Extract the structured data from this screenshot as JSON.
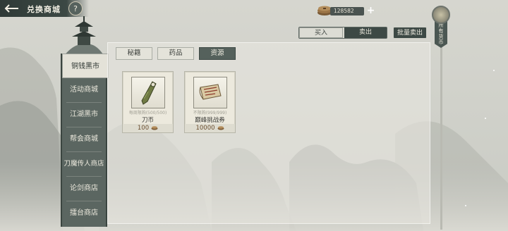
{
  "header": {
    "title": "兑换商城",
    "help_label": "?"
  },
  "currency": {
    "amount": "128582",
    "plus_label": "+"
  },
  "trade": {
    "buy_label": "买入",
    "sell_label": "卖出",
    "bulk_sell_label": "批量卖出",
    "selected": "buy"
  },
  "ornament": {
    "banner_chars": [
      "所",
      "有",
      "货",
      "币"
    ]
  },
  "sidebar": {
    "items": [
      {
        "label": "铜钱黑市",
        "active": true
      },
      {
        "label": "活动商城",
        "active": false
      },
      {
        "label": "江湖黑市",
        "active": false
      },
      {
        "label": "帮会商城",
        "active": false
      },
      {
        "label": "刀魔传人商店",
        "active": false
      },
      {
        "label": "论剑商店",
        "active": false
      },
      {
        "label": "擂台商店",
        "active": false
      }
    ]
  },
  "category_tabs": [
    {
      "label": "秘籍",
      "active": false
    },
    {
      "label": "药品",
      "active": false
    },
    {
      "label": "资源",
      "active": true
    }
  ],
  "items": [
    {
      "name": "刀币",
      "limit": "每周限购(500/500)",
      "price": "100",
      "icon": "blade-coin-icon"
    },
    {
      "name": "巅峰挑战券",
      "limit": "不限购(999/999)",
      "price": "10000",
      "icon": "challenge-ticket-icon"
    }
  ],
  "colors": {
    "panel_dark": "#5b6661",
    "accent_dark": "#3d4945",
    "price_text": "#6b4e2f"
  }
}
